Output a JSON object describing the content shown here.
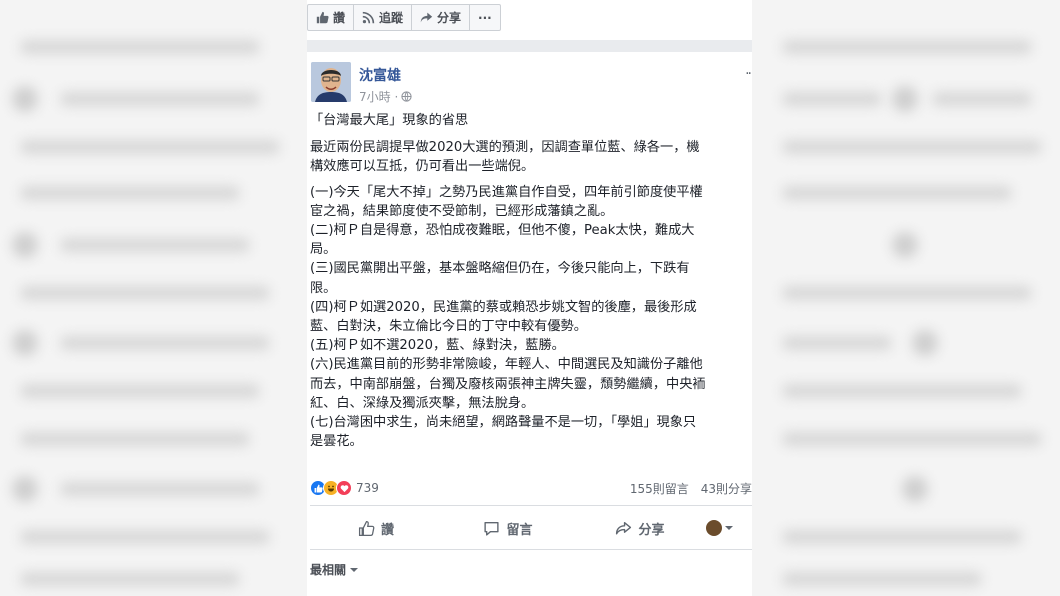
{
  "top_actions": {
    "like": "讚",
    "follow": "追蹤",
    "share": "分享",
    "more": "···"
  },
  "post": {
    "author": "沈富雄",
    "time": "7小時 ·",
    "title": "「台灣最大尾」現象的省思",
    "intro": [
      "最近兩份民調提早做2020大選的預測，因調查單位藍、綠各一，機",
      "構效應可以互抵，仍可看出一些端倪。"
    ],
    "items": [
      "(一)今天「尾大不掉」之勢乃民進黨自作自受，四年前引節度使平權",
      "宦之禍，結果節度使不受節制，已經形成藩鎮之亂。",
      "(二)柯Ｐ自是得意，恐怕成夜難眠，但他不傻，Peak太快，難成大",
      "局。",
      "(三)國民黨開出平盤，基本盤略縮但仍在，今後只能向上，下跌有",
      "限。",
      "(四)柯Ｐ如選2020，民進黨的蔡或賴恐步姚文智的後塵，最後形成",
      "藍、白對決，朱立倫比今日的丁守中較有優勢。",
      "(五)柯Ｐ如不選2020，藍、綠對決，藍勝。",
      "(六)民進黨目前的形勢非常險峻，年輕人、中間選民及知識份子離他",
      "而去，中南部崩盤，台獨及廢核兩張神主牌失靈，頹勢繼續，中央袻",
      "紅、白、深綠及獨派夾擊，無法脫身。",
      "(七)台灣困中求生，尚未絕望，網路聲量不是一切，「學姐」現象只",
      "是曇花。"
    ],
    "reaction_count": "739",
    "comments": "155則留言",
    "shares": "43則分享"
  },
  "actions": {
    "like": "讚",
    "comment": "留言",
    "share": "分享"
  },
  "sort_label": "最相關",
  "colors": {
    "link": "#365899",
    "like_blue": "#1877f2",
    "haha_yellow": "#f7b125",
    "love_red": "#f33e58"
  },
  "icons": [
    "thumbs-up-icon",
    "rss-icon",
    "share-arrow-icon",
    "globe-icon",
    "comment-icon",
    "chevron-down-icon"
  ]
}
